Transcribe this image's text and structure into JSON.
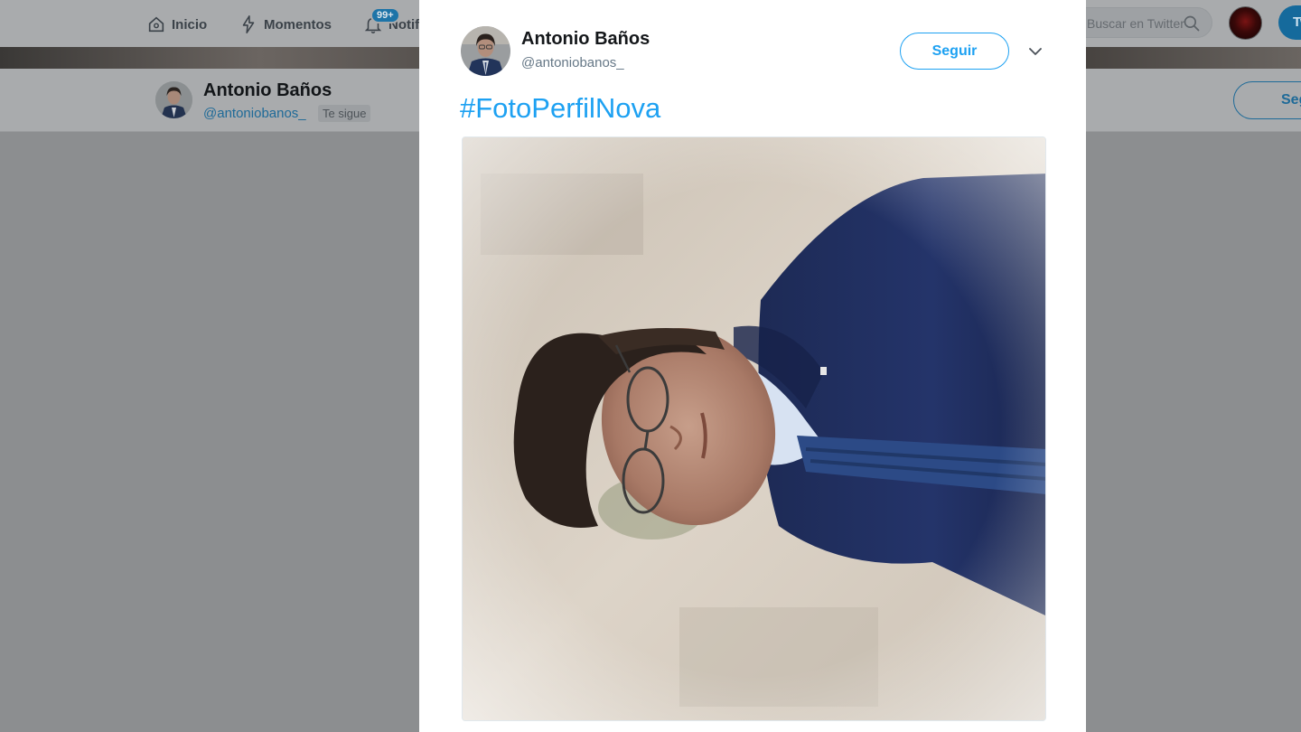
{
  "nav": {
    "home_label": "Inicio",
    "moments_label": "Momentos",
    "notifications_label": "Notificaciones",
    "notifications_badge": "99+",
    "search_placeholder": "Buscar en Twitter",
    "tweet_button": "Twittear"
  },
  "profile_bar": {
    "name": "Antonio Baños",
    "handle": "@antoniobanos_",
    "follows_you": "Te sigue",
    "follow_button": "Seguir"
  },
  "tweet": {
    "author_name": "Antonio Baños",
    "author_handle": "@antoniobanos_",
    "follow_button": "Seguir",
    "text": "#FotoPerfilNova",
    "photo_alt": "rotated portrait photo of a man with glasses in a navy suit"
  },
  "colors": {
    "accent": "#1da1f2",
    "handle_gray": "#657786",
    "overlay_bg": "#8c8e90"
  },
  "icons": {
    "home": "home-icon",
    "moments": "lightning-icon",
    "notifications": "bell-icon",
    "search": "search-icon",
    "caret": "chevron-down-icon"
  }
}
